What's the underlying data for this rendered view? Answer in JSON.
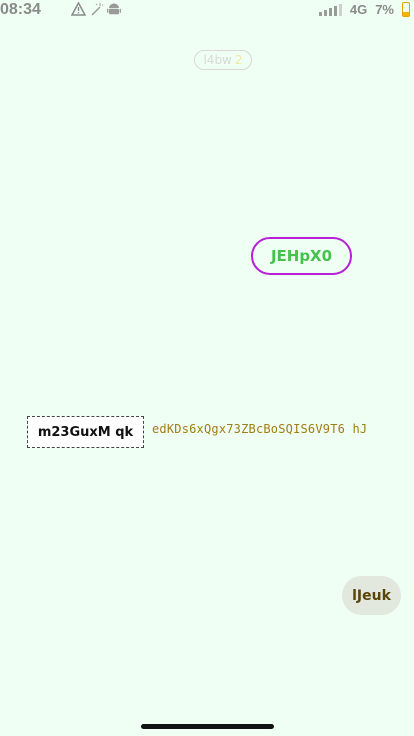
{
  "status_bar": {
    "time": "08:34",
    "network": "4G",
    "battery": "7%",
    "icons": [
      "warning-icon",
      "magic-icon",
      "android-icon",
      "signal-icon",
      "battery-icon"
    ]
  },
  "top_pill": {
    "text": "l4bw",
    "accent_text": "2"
  },
  "purple_button": {
    "label": "JEHpX0"
  },
  "dashed_button": {
    "label": "m23GuxM qk"
  },
  "mono_text": "edKDs6xQgx73ZBcBoSQIS6V9T6 hJ",
  "gray_button": {
    "label": "lJeuk"
  },
  "colors": {
    "background": "#EFFFF3",
    "purple_border": "#B81FD8",
    "green_text": "#44C24A",
    "mono_text": "#A07D14"
  }
}
